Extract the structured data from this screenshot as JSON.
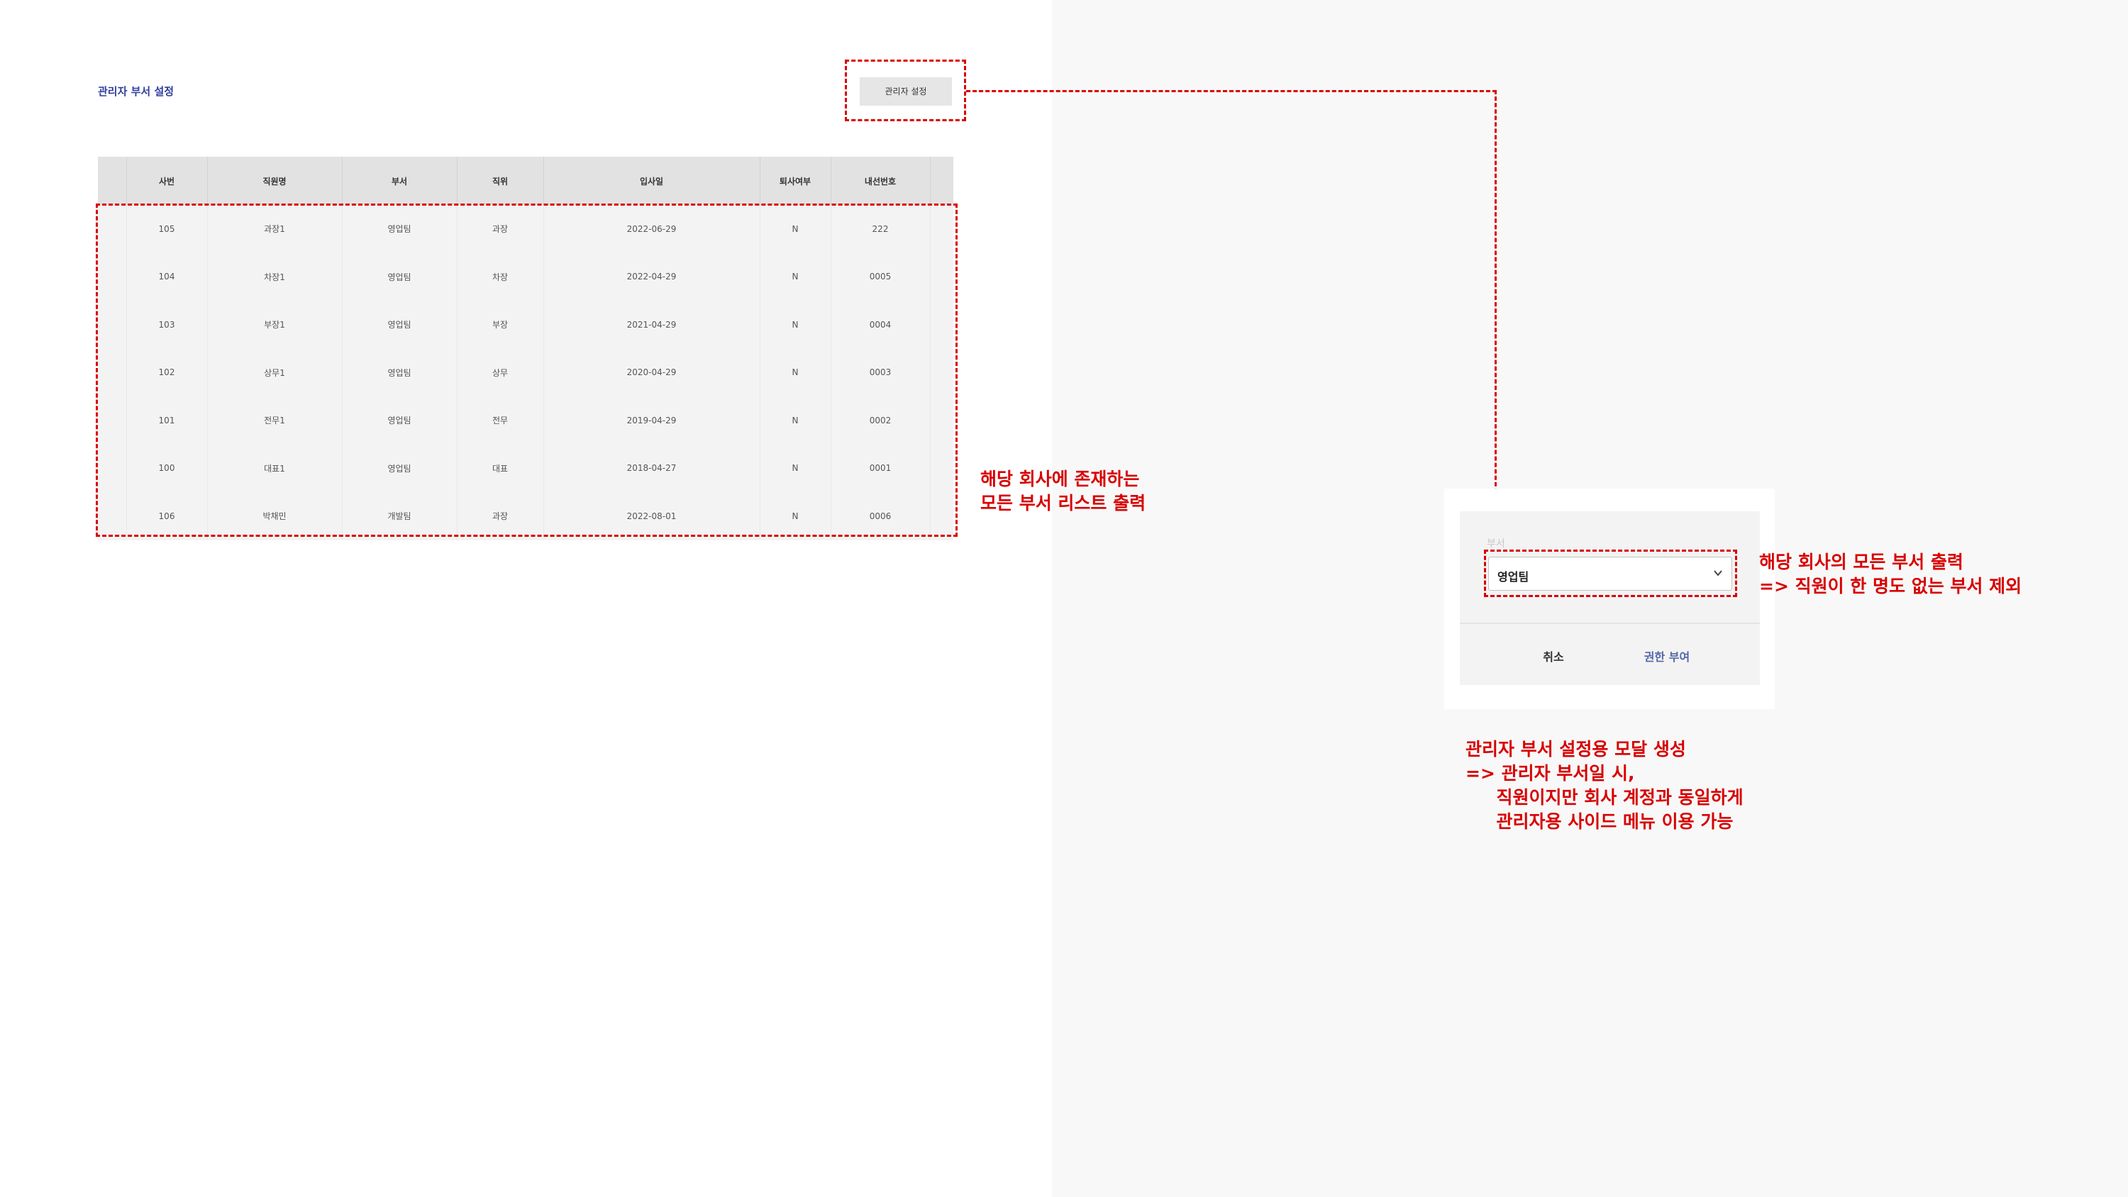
{
  "page": {
    "title": "관리자 부서 설정"
  },
  "toolbar": {
    "admin_button": "관리자 설정"
  },
  "table": {
    "headers": [
      "사번",
      "직원명",
      "부서",
      "직위",
      "입사일",
      "퇴사여부",
      "내선번호"
    ],
    "rows": [
      [
        "105",
        "과장1",
        "영업팀",
        "과장",
        "2022-06-29",
        "N",
        "222"
      ],
      [
        "104",
        "차장1",
        "영업팀",
        "차장",
        "2022-04-29",
        "N",
        "0005"
      ],
      [
        "103",
        "부장1",
        "영업팀",
        "부장",
        "2021-04-29",
        "N",
        "0004"
      ],
      [
        "102",
        "상무1",
        "영업팀",
        "상무",
        "2020-04-29",
        "N",
        "0003"
      ],
      [
        "101",
        "전무1",
        "영업팀",
        "전무",
        "2019-04-29",
        "N",
        "0002"
      ],
      [
        "100",
        "대표1",
        "영업팀",
        "대표",
        "2018-04-27",
        "N",
        "0001"
      ],
      [
        "106",
        "박채민",
        "개발팀",
        "과장",
        "2022-08-01",
        "N",
        "0006"
      ]
    ]
  },
  "modal": {
    "field_label": "부서",
    "department_select": {
      "value": "영업팀"
    },
    "cancel_label": "취소",
    "grant_label": "권한 부여"
  },
  "annotations": {
    "list_note": "해당 회사에 존재하는\n모든 부서 리스트 출력",
    "select_note": "해당 회사의 모든 부서 출력\n=> 직원이 한 명도 없는 부서 제외",
    "modal_note": "관리자 부서 설정용 모달 생성\n=> 관리자 부서일 시,\n     직원이지만 회사 계정과 동일하게\n     관리자용 사이드 메뉴 이용 가능"
  },
  "colors": {
    "annotation": "#d80000",
    "title": "#30409c",
    "grant_button": "#5566a8"
  },
  "icons": {
    "select_arrow": "chevron-down-icon"
  }
}
